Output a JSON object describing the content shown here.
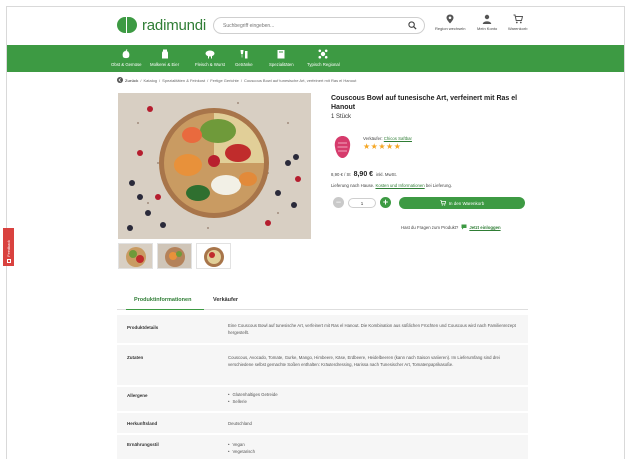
{
  "header": {
    "logo_text": "radimundi",
    "search_placeholder": "Suchbegriff eingeben...",
    "actions": [
      {
        "label": "Region wechseln",
        "icon": "location-pin-icon"
      },
      {
        "label": "Mein Konto",
        "icon": "user-icon"
      },
      {
        "label": "Warenkorb",
        "icon": "cart-icon"
      }
    ]
  },
  "nav": {
    "items": [
      {
        "label": "Obst & Gemüse",
        "icon": "vegetables-icon"
      },
      {
        "label": "Molkerei & Eier",
        "icon": "dairy-icon"
      },
      {
        "label": "Fleisch & Wurst",
        "icon": "meat-icon"
      },
      {
        "label": "Getränke",
        "icon": "drinks-icon"
      },
      {
        "label": "Spezialitäten",
        "icon": "specialties-icon"
      },
      {
        "label": "Typisch Regional",
        "icon": "regional-icon"
      }
    ]
  },
  "breadcrumb": {
    "items": [
      "Zurück",
      "/",
      "Katalog",
      "/",
      "Spezialitäten & Feinkost",
      "/",
      "Fertige Gerichte",
      "/",
      "Couscous Bowl auf tunesische Art, verfeinert mit Ras el Hanout"
    ]
  },
  "product": {
    "title": "Couscous Bowl auf tunesische Art, verfeinert mit Ras el Hanout",
    "unit": "1 Stück",
    "seller_prefix": "Verkäufer:",
    "seller_name": "Chicos Saftbar",
    "rating": 5,
    "stars": [
      "★",
      "★",
      "★",
      "★",
      "★"
    ],
    "price_per": "8,90 € / St",
    "price": "8,90 €",
    "price_vat": "inkl. MwSt.",
    "delivery_prefix": "Lieferung nach Hause.",
    "delivery_link": "Kosten und Informationen",
    "delivery_suffix": "bei Lieferung.",
    "quantity": "1",
    "minus": "−",
    "plus": "+",
    "cart_button": "In den Warenkorb",
    "question_text": "Hast du Fragen zum Produkt?",
    "question_link": "Jetzt einloggen"
  },
  "side_tab": {
    "label": "Feedback"
  },
  "tabs": [
    {
      "label": "Produktinformationen",
      "active": true
    },
    {
      "label": "Verkäufer",
      "active": false
    }
  ],
  "details": {
    "produktdetails": {
      "label": "Produktdetails",
      "value": "Eine Couscous Bowl auf tunesische Art, verfeinert mit Ras el Hanout. Die Kombination aus süßlichen Früchten und Couscous wird nach Familienrezept hergestellt."
    },
    "zutaten": {
      "label": "Zutaten",
      "value": "Couscous, Avocado, Tomate, Gurke, Mango, Himbeere, Käse, Erdbeere, Heidelbeeren (kann nach Saison variieren). Im Lieferumfang sind drei verschiedene selbst gemachte Soßen enthalten: Kräuterdressing, Harissa nach Tunesischer Art, Tomatenpaprikasoße."
    },
    "allergene": {
      "label": "Allergene",
      "items": [
        "Glutenhaltiges Getreide",
        "Sellerie"
      ]
    },
    "herkunftsland": {
      "label": "Herkunftsland",
      "value": "Deutschland"
    },
    "ernaehrung": {
      "label": "Ernährungsstil",
      "items": [
        "Vegan",
        "Vegetarisch"
      ]
    }
  },
  "colors": {
    "brand_green": "#3d9a43",
    "star": "#f5a623",
    "feedback_red": "#d9423f"
  }
}
